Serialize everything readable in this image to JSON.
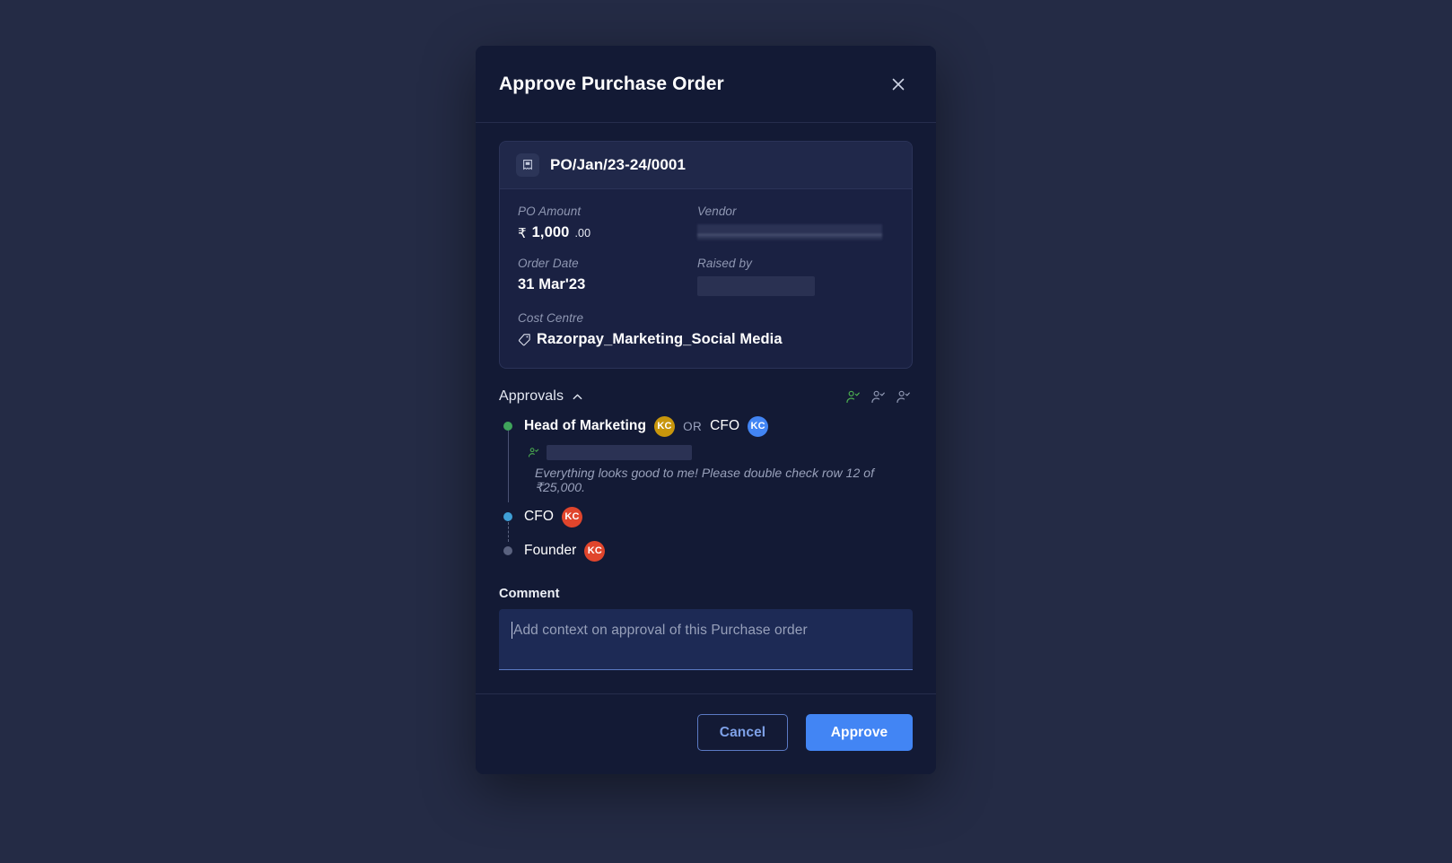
{
  "modal": {
    "title": "Approve Purchase Order",
    "close_icon": "close-icon"
  },
  "po_card": {
    "doc_icon": "receipt-document-icon",
    "po_number": "PO/Jan/23-24/0001",
    "fields": {
      "po_amount_label": "PO Amount",
      "po_amount_currency": "₹",
      "po_amount_value": "1,000",
      "po_amount_decimals": ".00",
      "vendor_label": "Vendor",
      "vendor_value": "",
      "order_date_label": "Order Date",
      "order_date_value": "31 Mar'23",
      "raised_by_label": "Raised by",
      "raised_by_value": "",
      "cost_centre_label": "Cost Centre",
      "cost_centre_icon": "tag-icon",
      "cost_centre_value": "Razorpay_Marketing_Social Media"
    }
  },
  "approvals": {
    "title": "Approvals",
    "collapse_icon": "chevron-up-icon",
    "status_icons": [
      {
        "name": "user-check-icon-approved",
        "color": "#4caf50"
      },
      {
        "name": "user-check-icon-pending",
        "color": "#8f97b2"
      },
      {
        "name": "user-check-icon-upcoming",
        "color": "#8f97b2"
      }
    ],
    "steps": [
      {
        "state": "approved",
        "dot_color": "#3fa45b",
        "roles": [
          {
            "label": "Head of Marketing",
            "avatar_initials": "KC",
            "avatar_color": "#c8960c"
          },
          {
            "label": "CFO",
            "avatar_initials": "KC",
            "avatar_color": "#4285f4"
          }
        ],
        "separator": "OR",
        "approved_by_icon": "user-check-icon",
        "approved_by_value": "",
        "comment": "Everything looks good to me! Please double check row 12 of ₹25,000."
      },
      {
        "state": "current",
        "dot_color": "#3f9fd6",
        "roles": [
          {
            "label": "CFO",
            "avatar_initials": "KC",
            "avatar_color": "#e0452c"
          }
        ]
      },
      {
        "state": "upcoming",
        "dot_color": "#5a627f",
        "roles": [
          {
            "label": "Founder",
            "avatar_initials": "KC",
            "avatar_color": "#e0452c"
          }
        ]
      }
    ]
  },
  "comment": {
    "label": "Comment",
    "placeholder": "Add context on approval of this Purchase order",
    "value": ""
  },
  "footer": {
    "cancel_label": "Cancel",
    "approve_label": "Approve"
  },
  "colors": {
    "page_background": "#242b45",
    "modal_background": "#131a35",
    "card_header": "#20284a",
    "card_body": "#1a2142",
    "primary_accent": "#4285f4",
    "approved_green": "#3fa45b",
    "current_blue": "#3f9fd6"
  }
}
